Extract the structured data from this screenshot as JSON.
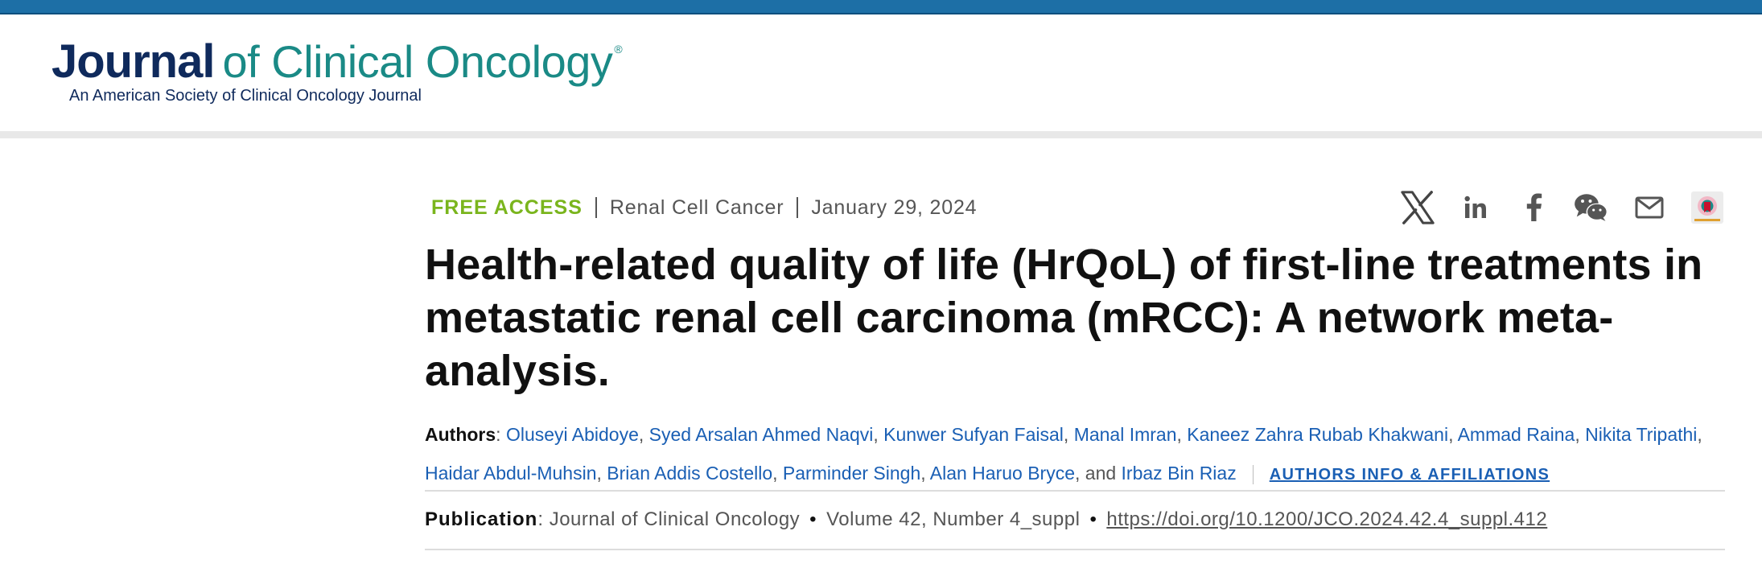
{
  "brand": {
    "journal_word": "Journal",
    "rest": "of Clinical Oncology",
    "registered": "®",
    "subtitle": "An American Society of Clinical Oncology Journal",
    "colors": {
      "navy": "#0f2a5c",
      "teal": "#1a8a86",
      "topbar": "#1d6fa6"
    }
  },
  "article": {
    "access": "FREE ACCESS",
    "category": "Renal Cell Cancer",
    "date": "January 29, 2024",
    "title": "Health-related quality of life (HrQoL) of first-line treatments in metastatic renal cell carcinoma (mRCC): A network meta-analysis.",
    "authors_label": "Authors",
    "authors": [
      "Oluseyi Abidoye",
      "Syed Arsalan Ahmed Naqvi",
      "Kunwer Sufyan Faisal",
      "Manal Imran",
      "Kaneez Zahra Rubab Khakwani",
      "Ammad Raina",
      "Nikita Tripathi",
      "Haidar Abdul-Muhsin",
      "Brian Addis Costello",
      "Parminder Singh",
      "Alan Haruo Bryce",
      "Irbaz Bin Riaz"
    ],
    "and_word": "and",
    "affiliations_link": "AUTHORS INFO & AFFILIATIONS",
    "publication_label": "Publication",
    "journal": "Journal of Clinical Oncology",
    "volume": "Volume 42, Number 4_suppl",
    "doi": "https://doi.org/10.1200/JCO.2024.42.4_suppl.412"
  },
  "share": {
    "icons": [
      "x-icon",
      "linkedin-icon",
      "facebook-icon",
      "wechat-icon",
      "email-icon",
      "mendeley-icon"
    ]
  }
}
